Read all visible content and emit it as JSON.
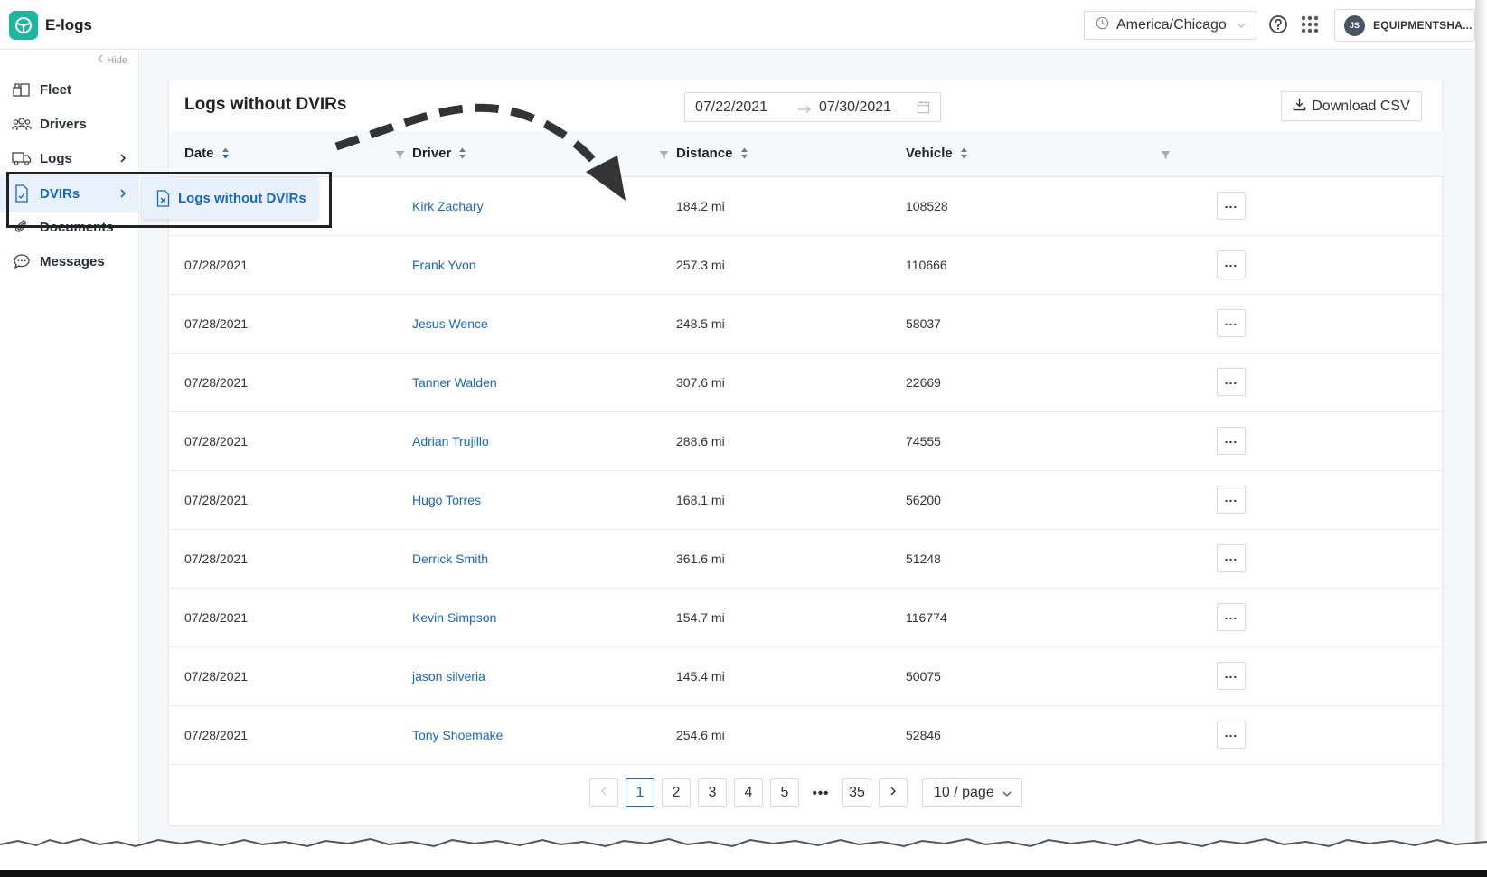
{
  "app": {
    "name": "E-logs"
  },
  "header": {
    "timezone": "America/Chicago",
    "user_initials": "JS",
    "user_name": "EQUIPMENTSHA..."
  },
  "sidebar": {
    "hide_label": "Hide",
    "items": [
      {
        "label": "Fleet",
        "icon": "fleet-icon"
      },
      {
        "label": "Drivers",
        "icon": "drivers-icon"
      },
      {
        "label": "Logs",
        "icon": "truck-icon"
      },
      {
        "label": "DVIRs",
        "icon": "dvir-icon"
      },
      {
        "label": "Documents",
        "icon": "paperclip-icon"
      },
      {
        "label": "Messages",
        "icon": "message-icon"
      }
    ],
    "submenu_label": "Logs without DVIRs"
  },
  "main": {
    "title": "Logs without DVIRs",
    "date_start": "07/22/2021",
    "date_end": "07/30/2021",
    "download_label": "Download CSV",
    "columns": [
      "Date",
      "Driver",
      "Distance",
      "Vehicle"
    ],
    "rows": [
      {
        "date": "",
        "driver": "Kirk Zachary",
        "distance": "184.2 mi",
        "vehicle": "108528"
      },
      {
        "date": "07/28/2021",
        "driver": "Frank Yvon",
        "distance": "257.3 mi",
        "vehicle": "110666"
      },
      {
        "date": "07/28/2021",
        "driver": "Jesus Wence",
        "distance": "248.5 mi",
        "vehicle": "58037"
      },
      {
        "date": "07/28/2021",
        "driver": "Tanner Walden",
        "distance": "307.6 mi",
        "vehicle": "22669"
      },
      {
        "date": "07/28/2021",
        "driver": "Adrian Trujillo",
        "distance": "288.6 mi",
        "vehicle": "74555"
      },
      {
        "date": "07/28/2021",
        "driver": "Hugo Torres",
        "distance": "168.1 mi",
        "vehicle": "56200"
      },
      {
        "date": "07/28/2021",
        "driver": "Derrick Smith",
        "distance": "361.6 mi",
        "vehicle": "51248"
      },
      {
        "date": "07/28/2021",
        "driver": "Kevin Simpson",
        "distance": "154.7 mi",
        "vehicle": "116774"
      },
      {
        "date": "07/28/2021",
        "driver": "jason silveria",
        "distance": "145.4 mi",
        "vehicle": "50075"
      },
      {
        "date": "07/28/2021",
        "driver": "Tony Shoemake",
        "distance": "254.6 mi",
        "vehicle": "52846"
      }
    ],
    "pagination": {
      "pages": [
        "1",
        "2",
        "3",
        "4",
        "5"
      ],
      "ellipsis": "•••",
      "last": "35",
      "current": "1",
      "page_size": "10 / page"
    }
  },
  "colors": {
    "accent": "#1766c4",
    "brand": "#1fb6a0",
    "active_bg": "#e9f2fc"
  }
}
